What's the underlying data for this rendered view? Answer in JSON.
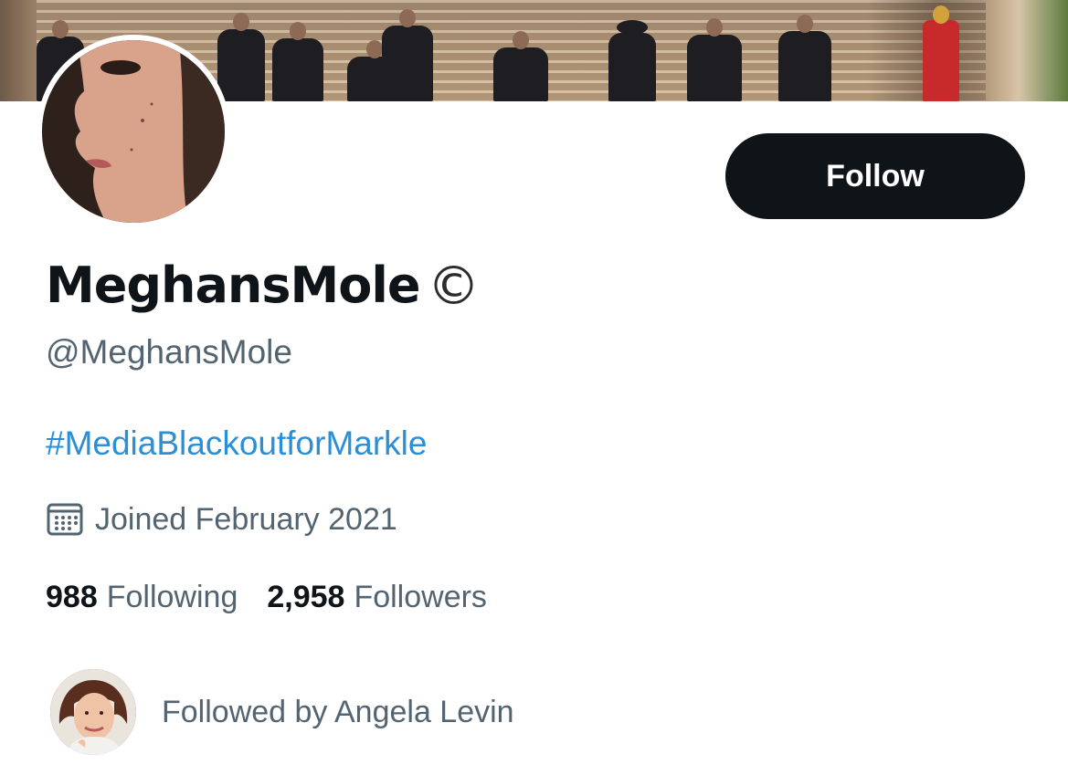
{
  "profile": {
    "display_name": "MeghansMole",
    "badge_glyph": "©",
    "handle": "@MeghansMole",
    "bio_hashtag": "#MediaBlackoutforMarkle",
    "joined": "Joined February 2021",
    "follow_label": "Follow"
  },
  "stats": {
    "following_count": "988",
    "following_label": "Following",
    "followers_count": "2,958",
    "followers_label": "Followers"
  },
  "followed_by": {
    "text": "Followed by Angela Levin"
  },
  "icons": {
    "calendar": "calendar-icon",
    "badge": "copyright-badge-icon"
  },
  "colors": {
    "follow_button_bg": "#0f1419",
    "hashtag": "#2a8fd6",
    "secondary_text": "#536471",
    "primary_text": "#0f1419"
  }
}
